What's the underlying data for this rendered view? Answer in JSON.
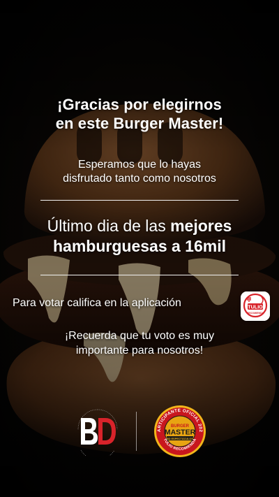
{
  "story": {
    "headline_line1": "¡Gracias por elegirnos",
    "headline_line2": "en este Burger Master!",
    "sub_line1": "Esperamos que lo hayas",
    "sub_line2": "disfrutado tanto como nosotros",
    "promo_line1_regular": "Último dia de las ",
    "promo_line1_bold": "mejores",
    "promo_line2": "hamburguesas a 16mil",
    "vote_text": "Para votar califica en la aplicación",
    "remember_line1": "¡Recuerda que tu voto es muy",
    "remember_line2": "importante para nosotros!"
  },
  "app_badge": {
    "icon": "tulio-recomienda-app-icon",
    "label": "TULIO",
    "sublabel": "RECOMIENDA"
  },
  "brand_logo": {
    "icon": "bd-logo-icon",
    "letters": "BD"
  },
  "event_seal": {
    "icon": "burger-master-seal-icon",
    "top_text": "PARTICIPANTE OFICIAL 2023",
    "title_top": "BURGER",
    "title_main": "MASTER",
    "banner": "BD ESPECTÁCULOS",
    "bottom_text": "TULIO RECOMIENDA"
  },
  "colors": {
    "text": "#ffffff",
    "brand_red": "#d8232a",
    "seal_red": "#c8161e",
    "seal_gold": "#f2b51b"
  }
}
